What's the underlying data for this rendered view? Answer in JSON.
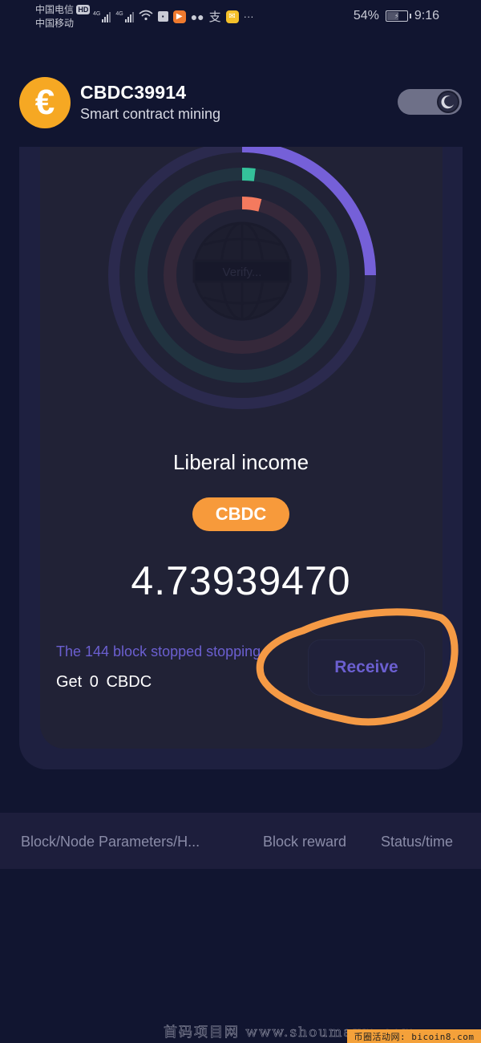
{
  "status_bar": {
    "carrier_1": "中国电信",
    "carrier_1_badge": "HD",
    "carrier_2": "中国移动",
    "network_1": "4G",
    "network_2": "4G",
    "battery_percent": "54%",
    "battery_level": 0.54,
    "time": "9:16",
    "more": "···"
  },
  "header": {
    "coin_symbol": "€",
    "title": "CBDC39914",
    "subtitle": "Smart contract mining",
    "dark_mode_toggle": "on"
  },
  "rings": {
    "center_label": "Verify...",
    "outer_progress": 0.25,
    "middle_progress": 0.02,
    "inner_progress": 0.04,
    "colors": {
      "outer": "#7560d8",
      "outer_track": "#2b2a4e",
      "middle": "#34c29a",
      "middle_track": "#213340",
      "inner": "#f47a5e",
      "inner_track": "#35283a"
    }
  },
  "income": {
    "label": "Liberal income",
    "token": "CBDC",
    "amount": "4.73939470",
    "block_status": "The 144 block stopped stopping",
    "get_amount": "Get  0  CBDC",
    "receive_label": "Receive"
  },
  "table": {
    "columns": [
      "Block/Node Parameters/H...",
      "Block reward",
      "Status/time"
    ]
  },
  "watermark": {
    "text": "首码项目网 www.shoumaxm.com",
    "promo": "币圈活动网: bicoin8.com"
  },
  "colors": {
    "background": "#111530",
    "accent_orange": "#f79a3b",
    "accent_purple": "#6b5fd0",
    "coin": "#f6a823"
  }
}
